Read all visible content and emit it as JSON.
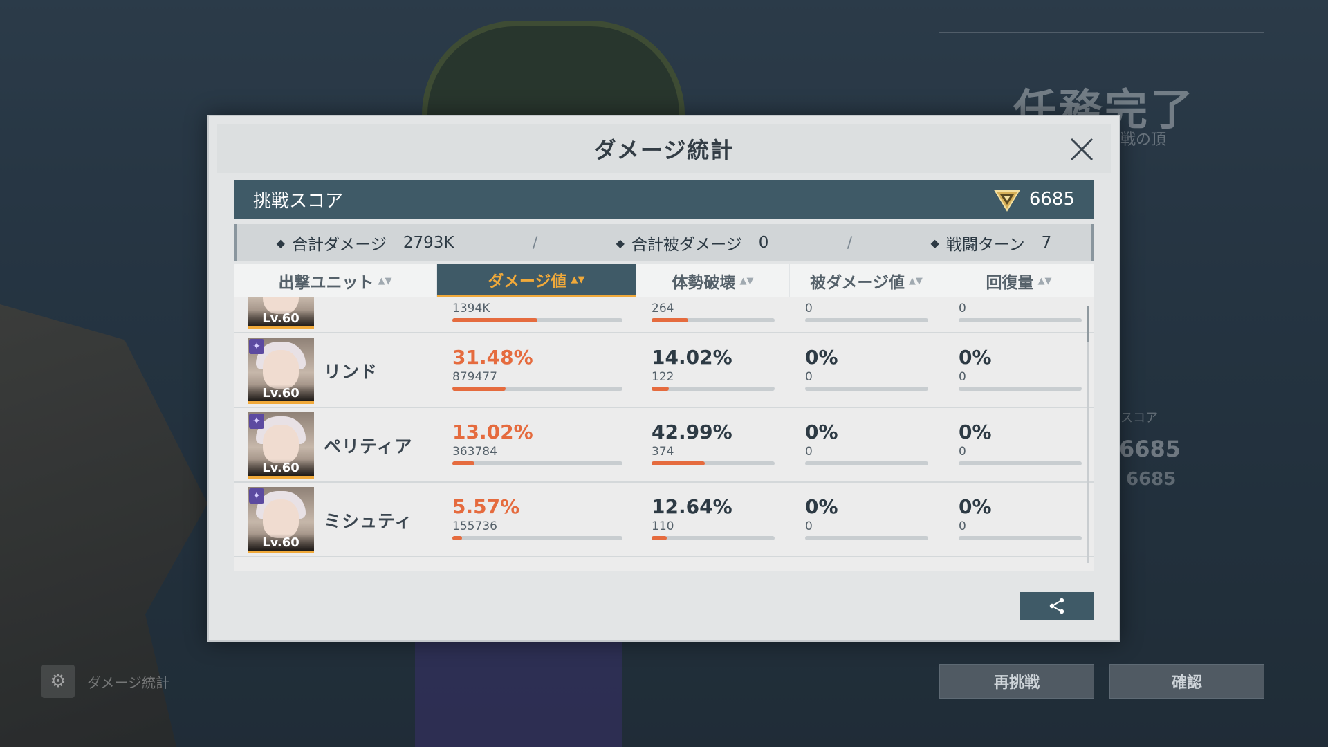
{
  "background": {
    "mission_title": "任務完了",
    "mission_subtitle": "戦の頂",
    "score_label": "スコア",
    "score_value": "6685",
    "score_value_2": "6685",
    "retry_button": "再挑戦",
    "confirm_button": "確認",
    "damage_stats_link": "ダメージ統計"
  },
  "modal": {
    "title": "ダメージ統計",
    "score_bar": {
      "label": "挑戦スコア",
      "value": "6685",
      "icon": "triangle-badge-icon"
    },
    "summary": [
      {
        "label": "合計ダメージ",
        "value": "2793K"
      },
      {
        "label": "合計被ダメージ",
        "value": "0"
      },
      {
        "label": "戦闘ターン",
        "value": "7"
      }
    ],
    "separator": "/",
    "columns": [
      {
        "label": "出撃ユニット",
        "active": false
      },
      {
        "label": "ダメージ値",
        "active": true
      },
      {
        "label": "体勢破壊",
        "active": false
      },
      {
        "label": "被ダメージ値",
        "active": false
      },
      {
        "label": "回復量",
        "active": false
      }
    ],
    "rows": [
      {
        "name": "",
        "level": "Lv.60",
        "damage": {
          "pct": "",
          "value": "1394K",
          "fill": 0.5
        },
        "break": {
          "pct": "",
          "value": "264",
          "fill": 0.3
        },
        "taken": {
          "pct": "",
          "value": "0",
          "fill": 0
        },
        "heal": {
          "pct": "",
          "value": "0",
          "fill": 0
        }
      },
      {
        "name": "リンド",
        "level": "Lv.60",
        "damage": {
          "pct": "31.48%",
          "value": "879477",
          "fill": 0.3148
        },
        "break": {
          "pct": "14.02%",
          "value": "122",
          "fill": 0.1402
        },
        "taken": {
          "pct": "0%",
          "value": "0",
          "fill": 0
        },
        "heal": {
          "pct": "0%",
          "value": "0",
          "fill": 0
        }
      },
      {
        "name": "ペリティア",
        "level": "Lv.60",
        "damage": {
          "pct": "13.02%",
          "value": "363784",
          "fill": 0.1302
        },
        "break": {
          "pct": "42.99%",
          "value": "374",
          "fill": 0.4299
        },
        "taken": {
          "pct": "0%",
          "value": "0",
          "fill": 0
        },
        "heal": {
          "pct": "0%",
          "value": "0",
          "fill": 0
        }
      },
      {
        "name": "ミシュティ",
        "level": "Lv.60",
        "damage": {
          "pct": "5.57%",
          "value": "155736",
          "fill": 0.0557
        },
        "break": {
          "pct": "12.64%",
          "value": "110",
          "fill": 0.1264
        },
        "taken": {
          "pct": "0%",
          "value": "0",
          "fill": 0
        },
        "heal": {
          "pct": "0%",
          "value": "0",
          "fill": 0
        }
      }
    ],
    "share_icon": "share-icon",
    "close_icon": "close-icon"
  },
  "colors": {
    "accent_orange": "#e56b3e",
    "active_tab_text": "#f0a93a",
    "header_bar": "#3f5a67"
  }
}
